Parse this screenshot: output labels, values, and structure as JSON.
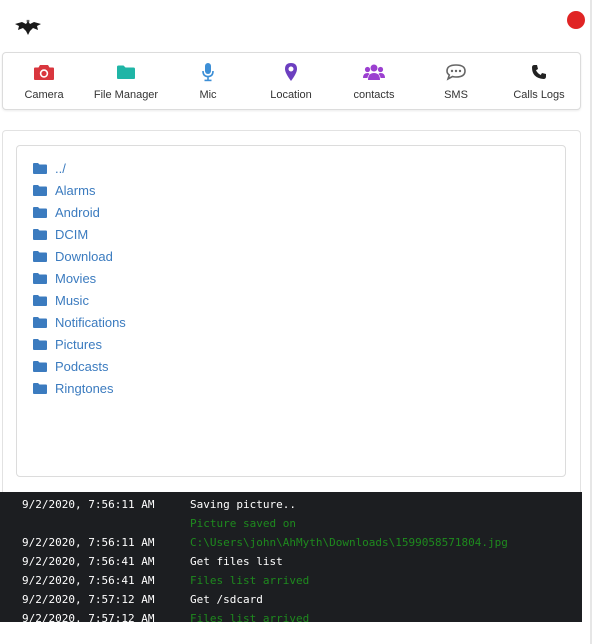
{
  "header": {
    "logo_icon": "bat-logo-icon",
    "close_color": "#e02424"
  },
  "menu": {
    "items": [
      {
        "label": "Camera",
        "icon": "camera-icon",
        "color": "#d9363e"
      },
      {
        "label": "File Manager",
        "icon": "folder-icon",
        "color": "#1fb5a6"
      },
      {
        "label": "Mic",
        "icon": "microphone-icon",
        "color": "#3d8fd6"
      },
      {
        "label": "Location",
        "icon": "map-marker-icon",
        "color": "#6c3fc0"
      },
      {
        "label": "contacts",
        "icon": "users-icon",
        "color": "#9b3fd0"
      },
      {
        "label": "SMS",
        "icon": "sms-icon",
        "color": "#666666"
      },
      {
        "label": "Calls Logs",
        "icon": "phone-icon",
        "color": "#222222"
      }
    ]
  },
  "files": {
    "folder_color": "#3b7bbf",
    "items": [
      {
        "name": "../"
      },
      {
        "name": "Alarms"
      },
      {
        "name": "Android"
      },
      {
        "name": "DCIM"
      },
      {
        "name": "Download"
      },
      {
        "name": "Movies"
      },
      {
        "name": "Music"
      },
      {
        "name": "Notifications"
      },
      {
        "name": "Pictures"
      },
      {
        "name": "Podcasts"
      },
      {
        "name": "Ringtones"
      }
    ]
  },
  "log": {
    "rows": [
      {
        "time": "9/2/2020, 7:56:11 AM",
        "msg": "Saving picture..",
        "color": "white"
      },
      {
        "time": "",
        "msg": "Picture saved on",
        "color": "green"
      },
      {
        "time": "9/2/2020, 7:56:11 AM",
        "msg": "C:\\Users\\john\\AhMyth\\Downloads\\1599058571804.jpg",
        "color": "green"
      },
      {
        "time": "9/2/2020, 7:56:41 AM",
        "msg": "Get files list",
        "color": "white"
      },
      {
        "time": "9/2/2020, 7:56:41 AM",
        "msg": "Files list arrived",
        "color": "green"
      },
      {
        "time": "9/2/2020, 7:57:12 AM",
        "msg": "Get /sdcard",
        "color": "white"
      },
      {
        "time": "9/2/2020, 7:57:12 AM",
        "msg": "Files list arrived",
        "color": "green"
      }
    ]
  }
}
